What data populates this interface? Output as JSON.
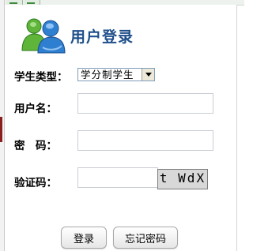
{
  "header": {
    "title": "用户登录",
    "logo_icon": "msn-users-icon"
  },
  "form": {
    "student_type_label": "学生类型：",
    "student_type_value": "学分制学生",
    "username_label": "用户名：",
    "username_value": "",
    "password_label": "密　码：",
    "password_value": "",
    "captcha_label": "验证码：",
    "captcha_value": "",
    "captcha_text": "t WdX"
  },
  "actions": {
    "login_label": "登录",
    "forgot_label": "忘记密码"
  },
  "colors": {
    "title": "#1e4f8a",
    "accent_green": "#3d8a3d"
  }
}
